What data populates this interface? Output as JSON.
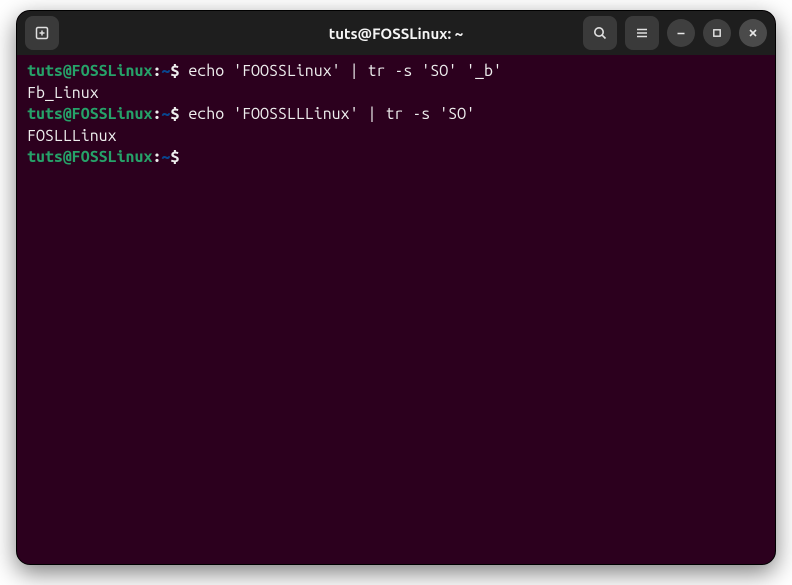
{
  "window": {
    "title": "tuts@FOSSLinux: ~"
  },
  "prompt": {
    "user_host": "tuts@FOSSLinux",
    "colon": ":",
    "path": "~",
    "symbol": "$"
  },
  "lines": {
    "cmd1": " echo 'FOOSSLinux' | tr -s 'SO' '_b'",
    "out1": "Fb_Linux",
    "cmd2": " echo 'FOOSSLLLinux' | tr -s 'SO'",
    "out2": "FOSLLLinux",
    "cmd3": " "
  },
  "colors": {
    "terminal_bg": "#2c001e",
    "titlebar_bg": "#1e1e1e",
    "prompt_user": "#26a269",
    "prompt_path": "#08458f",
    "text": "#eeeeee"
  }
}
